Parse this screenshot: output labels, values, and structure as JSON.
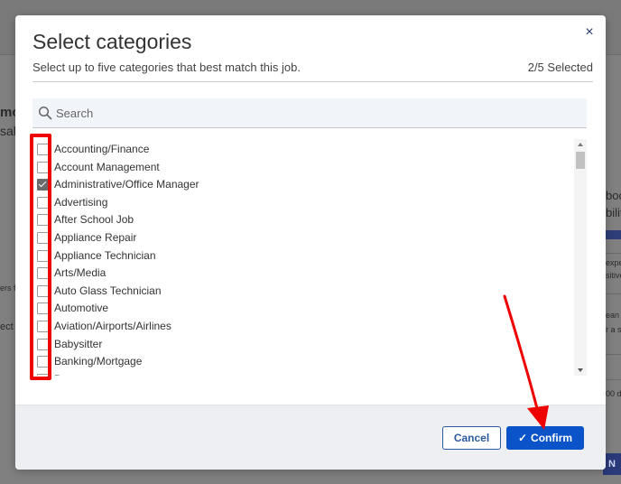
{
  "background": {
    "fragments": [
      "mo",
      "sal",
      "ers f",
      "ect",
      "boo",
      "bility",
      "expe",
      "sitive",
      "ean i",
      "r a sa",
      "00 d",
      "N"
    ]
  },
  "modal": {
    "title": "Select categories",
    "subtitle": "Select up to five categories that best match this job.",
    "counter": "2/5 Selected",
    "close_icon": "×",
    "search": {
      "placeholder": "Search",
      "value": ""
    },
    "items": [
      {
        "label": "Accounting/Finance",
        "checked": false
      },
      {
        "label": "Account Management",
        "checked": false
      },
      {
        "label": "Administrative/Office Manager",
        "checked": true
      },
      {
        "label": "Advertising",
        "checked": false
      },
      {
        "label": "After School Job",
        "checked": false
      },
      {
        "label": "Appliance Repair",
        "checked": false
      },
      {
        "label": "Appliance Technician",
        "checked": false
      },
      {
        "label": "Arts/Media",
        "checked": false
      },
      {
        "label": "Auto Glass Technician",
        "checked": false
      },
      {
        "label": "Automotive",
        "checked": false
      },
      {
        "label": "Aviation/Airports/Airlines",
        "checked": false
      },
      {
        "label": "Babysitter",
        "checked": false
      },
      {
        "label": "Banking/Mortgage",
        "checked": false
      },
      {
        "label": "Beauty",
        "checked": false
      }
    ],
    "footer": {
      "cancel_label": "Cancel",
      "confirm_label": "Confirm",
      "confirm_icon": "✓"
    }
  },
  "colors": {
    "primary": "#0a53c8",
    "annotation": "#ee0000"
  }
}
